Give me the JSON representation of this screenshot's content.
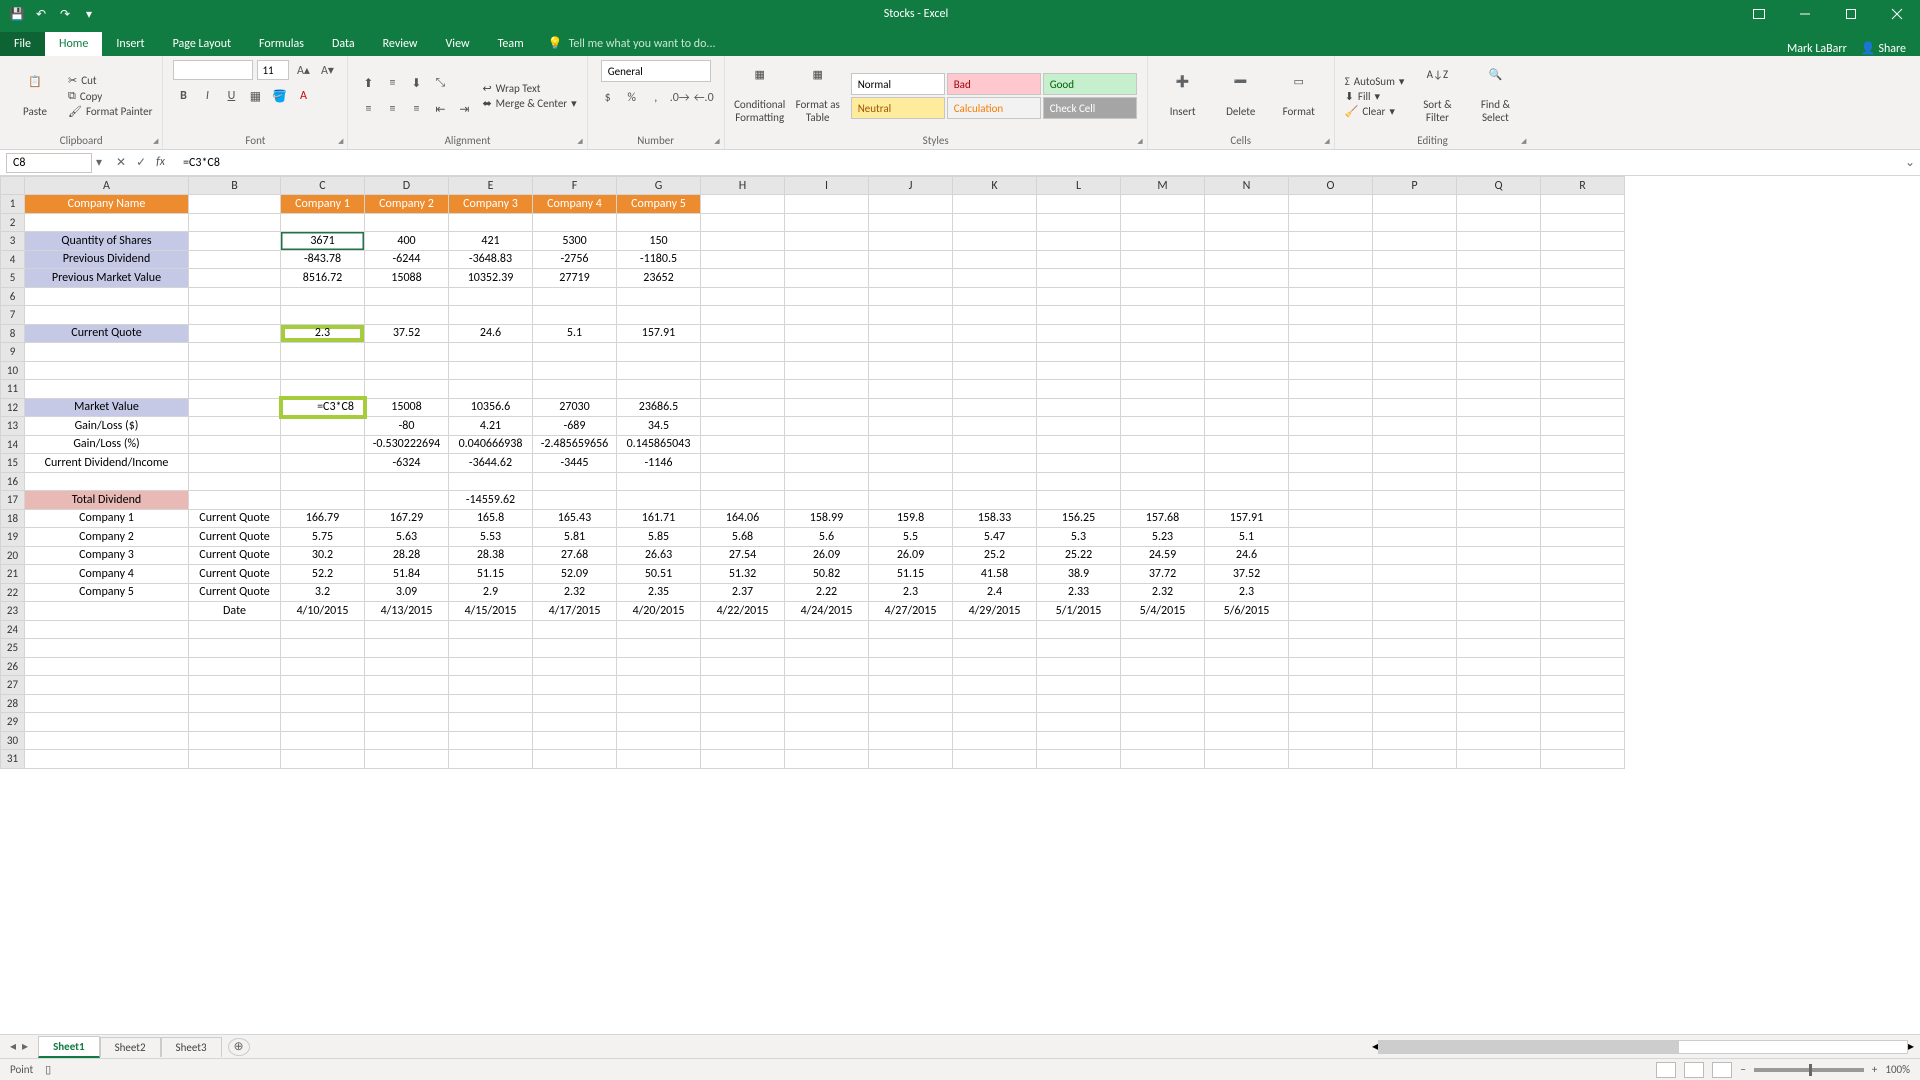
{
  "title": "Stocks - Excel",
  "user": "Mark LaBarr",
  "share": "Share",
  "qat": {
    "save": "save",
    "undo": "undo",
    "redo": "redo"
  },
  "tabs": [
    "File",
    "Home",
    "Insert",
    "Page Layout",
    "Formulas",
    "Data",
    "Review",
    "View",
    "Team"
  ],
  "active_tab": "Home",
  "tellme": "Tell me what you want to do...",
  "ribbon": {
    "clipboard": {
      "paste": "Paste",
      "cut": "Cut",
      "copy": "Copy",
      "fmtpainter": "Format Painter",
      "label": "Clipboard"
    },
    "font": {
      "name": "",
      "size": "11",
      "label": "Font"
    },
    "alignment": {
      "wrap": "Wrap Text",
      "merge": "Merge & Center",
      "label": "Alignment"
    },
    "number": {
      "format": "General",
      "label": "Number"
    },
    "styles": {
      "cond": "Conditional Formatting",
      "fmtas": "Format as Table",
      "cells": [
        "Normal",
        "Bad",
        "Good",
        "Neutral",
        "Calculation",
        "Check Cell"
      ],
      "label": "Styles"
    },
    "cells": {
      "insert": "Insert",
      "delete": "Delete",
      "format": "Format",
      "label": "Cells"
    },
    "editing": {
      "autosum": "AutoSum",
      "fill": "Fill",
      "clear": "Clear",
      "sort": "Sort & Filter",
      "find": "Find & Select",
      "label": "Editing"
    }
  },
  "fbar": {
    "namebox": "C8",
    "formula": "=C3*C8"
  },
  "columns": [
    "A",
    "B",
    "C",
    "D",
    "E",
    "F",
    "G",
    "H",
    "I",
    "J",
    "K",
    "L",
    "M",
    "N",
    "O",
    "P",
    "Q",
    "R"
  ],
  "row_count": 31,
  "rows": {
    "1": {
      "A": "Company Name",
      "C": "Company 1",
      "D": "Company 2",
      "E": "Company 3",
      "F": "Company 4",
      "G": "Company 5"
    },
    "3": {
      "A": "Quantity of Shares",
      "C": "3671",
      "D": "400",
      "E": "421",
      "F": "5300",
      "G": "150"
    },
    "4": {
      "A": "Previous Dividend",
      "C": "-843.78",
      "D": "-6244",
      "E": "-3648.83",
      "F": "-2756",
      "G": "-1180.5"
    },
    "5": {
      "A": "Previous Market Value",
      "C": "8516.72",
      "D": "15088",
      "E": "10352.39",
      "F": "27719",
      "G": "23652"
    },
    "8": {
      "A": "Current Quote",
      "C": "2.3",
      "D": "37.52",
      "E": "24.6",
      "F": "5.1",
      "G": "157.91"
    },
    "12": {
      "A": "Market Value",
      "C": "=C3*C8",
      "D": "15008",
      "E": "10356.6",
      "F": "27030",
      "G": "23686.5"
    },
    "13": {
      "A": "Gain/Loss ($)",
      "D": "-80",
      "E": "4.21",
      "F": "-689",
      "G": "34.5"
    },
    "14": {
      "A": "Gain/Loss (%)",
      "D": "-0.530222694",
      "E": "0.040666938",
      "F": "-2.485659656",
      "G": "0.145865043"
    },
    "15": {
      "A": "Current Dividend/Income",
      "D": "-6324",
      "E": "-3644.62",
      "F": "-3445",
      "G": "-1146"
    },
    "17": {
      "A": "Total Dividend",
      "E": "-14559.62"
    },
    "18": {
      "A": "Company 1",
      "B": "Current Quote",
      "C": "166.79",
      "D": "167.29",
      "E": "165.8",
      "F": "165.43",
      "G": "161.71",
      "H": "164.06",
      "I": "158.99",
      "J": "159.8",
      "K": "158.33",
      "L": "156.25",
      "M": "157.68",
      "N": "157.91"
    },
    "19": {
      "A": "Company 2",
      "B": "Current Quote",
      "C": "5.75",
      "D": "5.63",
      "E": "5.53",
      "F": "5.81",
      "G": "5.85",
      "H": "5.68",
      "I": "5.6",
      "J": "5.5",
      "K": "5.47",
      "L": "5.3",
      "M": "5.23",
      "N": "5.1"
    },
    "20": {
      "A": "Company 3",
      "B": "Current Quote",
      "C": "30.2",
      "D": "28.28",
      "E": "28.38",
      "F": "27.68",
      "G": "26.63",
      "H": "27.54",
      "I": "26.09",
      "J": "26.09",
      "K": "25.2",
      "L": "25.22",
      "M": "24.59",
      "N": "24.6"
    },
    "21": {
      "A": "Company 4",
      "B": "Current Quote",
      "C": "52.2",
      "D": "51.84",
      "E": "51.15",
      "F": "52.09",
      "G": "50.51",
      "H": "51.32",
      "I": "50.82",
      "J": "51.15",
      "K": "41.58",
      "L": "38.9",
      "M": "37.72",
      "N": "37.52"
    },
    "22": {
      "A": "Company 5",
      "B": "Current Quote",
      "C": "3.2",
      "D": "3.09",
      "E": "2.9",
      "F": "2.32",
      "G": "2.35",
      "H": "2.37",
      "I": "2.22",
      "J": "2.3",
      "K": "2.4",
      "L": "2.33",
      "M": "2.32",
      "N": "2.3"
    },
    "23": {
      "B": "Date",
      "C": "4/10/2015",
      "D": "4/13/2015",
      "E": "4/15/2015",
      "F": "4/17/2015",
      "G": "4/20/2015",
      "H": "4/22/2015",
      "I": "4/24/2015",
      "J": "4/27/2015",
      "K": "4/29/2015",
      "L": "5/1/2015",
      "M": "5/4/2015",
      "N": "5/6/2015"
    }
  },
  "sheets": [
    "Sheet1",
    "Sheet2",
    "Sheet3"
  ],
  "active_sheet": "Sheet1",
  "status": {
    "mode": "Point",
    "zoom": "100%"
  }
}
